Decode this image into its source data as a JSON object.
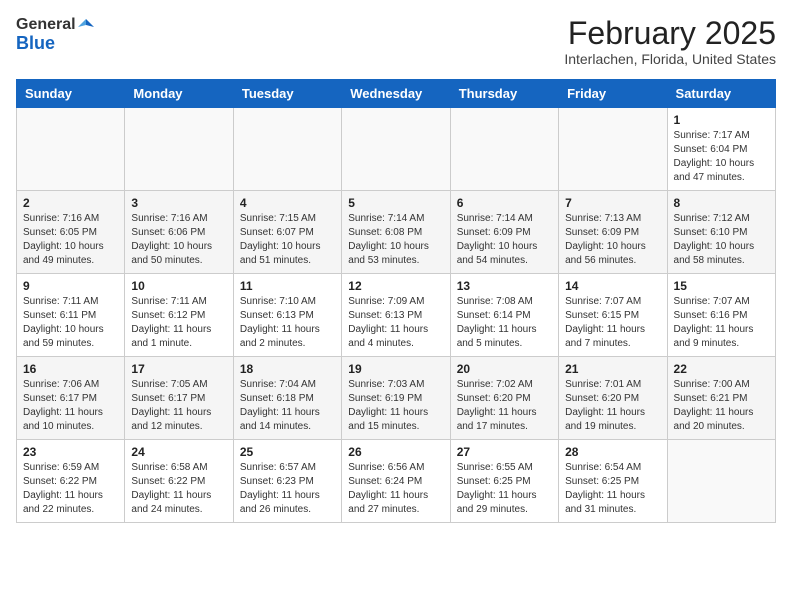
{
  "header": {
    "logo_general": "General",
    "logo_blue": "Blue",
    "title": "February 2025",
    "subtitle": "Interlachen, Florida, United States"
  },
  "weekdays": [
    "Sunday",
    "Monday",
    "Tuesday",
    "Wednesday",
    "Thursday",
    "Friday",
    "Saturday"
  ],
  "weeks": [
    [
      {
        "day": "",
        "info": ""
      },
      {
        "day": "",
        "info": ""
      },
      {
        "day": "",
        "info": ""
      },
      {
        "day": "",
        "info": ""
      },
      {
        "day": "",
        "info": ""
      },
      {
        "day": "",
        "info": ""
      },
      {
        "day": "1",
        "info": "Sunrise: 7:17 AM\nSunset: 6:04 PM\nDaylight: 10 hours\nand 47 minutes."
      }
    ],
    [
      {
        "day": "2",
        "info": "Sunrise: 7:16 AM\nSunset: 6:05 PM\nDaylight: 10 hours\nand 49 minutes."
      },
      {
        "day": "3",
        "info": "Sunrise: 7:16 AM\nSunset: 6:06 PM\nDaylight: 10 hours\nand 50 minutes."
      },
      {
        "day": "4",
        "info": "Sunrise: 7:15 AM\nSunset: 6:07 PM\nDaylight: 10 hours\nand 51 minutes."
      },
      {
        "day": "5",
        "info": "Sunrise: 7:14 AM\nSunset: 6:08 PM\nDaylight: 10 hours\nand 53 minutes."
      },
      {
        "day": "6",
        "info": "Sunrise: 7:14 AM\nSunset: 6:09 PM\nDaylight: 10 hours\nand 54 minutes."
      },
      {
        "day": "7",
        "info": "Sunrise: 7:13 AM\nSunset: 6:09 PM\nDaylight: 10 hours\nand 56 minutes."
      },
      {
        "day": "8",
        "info": "Sunrise: 7:12 AM\nSunset: 6:10 PM\nDaylight: 10 hours\nand 58 minutes."
      }
    ],
    [
      {
        "day": "9",
        "info": "Sunrise: 7:11 AM\nSunset: 6:11 PM\nDaylight: 10 hours\nand 59 minutes."
      },
      {
        "day": "10",
        "info": "Sunrise: 7:11 AM\nSunset: 6:12 PM\nDaylight: 11 hours\nand 1 minute."
      },
      {
        "day": "11",
        "info": "Sunrise: 7:10 AM\nSunset: 6:13 PM\nDaylight: 11 hours\nand 2 minutes."
      },
      {
        "day": "12",
        "info": "Sunrise: 7:09 AM\nSunset: 6:13 PM\nDaylight: 11 hours\nand 4 minutes."
      },
      {
        "day": "13",
        "info": "Sunrise: 7:08 AM\nSunset: 6:14 PM\nDaylight: 11 hours\nand 5 minutes."
      },
      {
        "day": "14",
        "info": "Sunrise: 7:07 AM\nSunset: 6:15 PM\nDaylight: 11 hours\nand 7 minutes."
      },
      {
        "day": "15",
        "info": "Sunrise: 7:07 AM\nSunset: 6:16 PM\nDaylight: 11 hours\nand 9 minutes."
      }
    ],
    [
      {
        "day": "16",
        "info": "Sunrise: 7:06 AM\nSunset: 6:17 PM\nDaylight: 11 hours\nand 10 minutes."
      },
      {
        "day": "17",
        "info": "Sunrise: 7:05 AM\nSunset: 6:17 PM\nDaylight: 11 hours\nand 12 minutes."
      },
      {
        "day": "18",
        "info": "Sunrise: 7:04 AM\nSunset: 6:18 PM\nDaylight: 11 hours\nand 14 minutes."
      },
      {
        "day": "19",
        "info": "Sunrise: 7:03 AM\nSunset: 6:19 PM\nDaylight: 11 hours\nand 15 minutes."
      },
      {
        "day": "20",
        "info": "Sunrise: 7:02 AM\nSunset: 6:20 PM\nDaylight: 11 hours\nand 17 minutes."
      },
      {
        "day": "21",
        "info": "Sunrise: 7:01 AM\nSunset: 6:20 PM\nDaylight: 11 hours\nand 19 minutes."
      },
      {
        "day": "22",
        "info": "Sunrise: 7:00 AM\nSunset: 6:21 PM\nDaylight: 11 hours\nand 20 minutes."
      }
    ],
    [
      {
        "day": "23",
        "info": "Sunrise: 6:59 AM\nSunset: 6:22 PM\nDaylight: 11 hours\nand 22 minutes."
      },
      {
        "day": "24",
        "info": "Sunrise: 6:58 AM\nSunset: 6:22 PM\nDaylight: 11 hours\nand 24 minutes."
      },
      {
        "day": "25",
        "info": "Sunrise: 6:57 AM\nSunset: 6:23 PM\nDaylight: 11 hours\nand 26 minutes."
      },
      {
        "day": "26",
        "info": "Sunrise: 6:56 AM\nSunset: 6:24 PM\nDaylight: 11 hours\nand 27 minutes."
      },
      {
        "day": "27",
        "info": "Sunrise: 6:55 AM\nSunset: 6:25 PM\nDaylight: 11 hours\nand 29 minutes."
      },
      {
        "day": "28",
        "info": "Sunrise: 6:54 AM\nSunset: 6:25 PM\nDaylight: 11 hours\nand 31 minutes."
      },
      {
        "day": "",
        "info": ""
      }
    ]
  ]
}
